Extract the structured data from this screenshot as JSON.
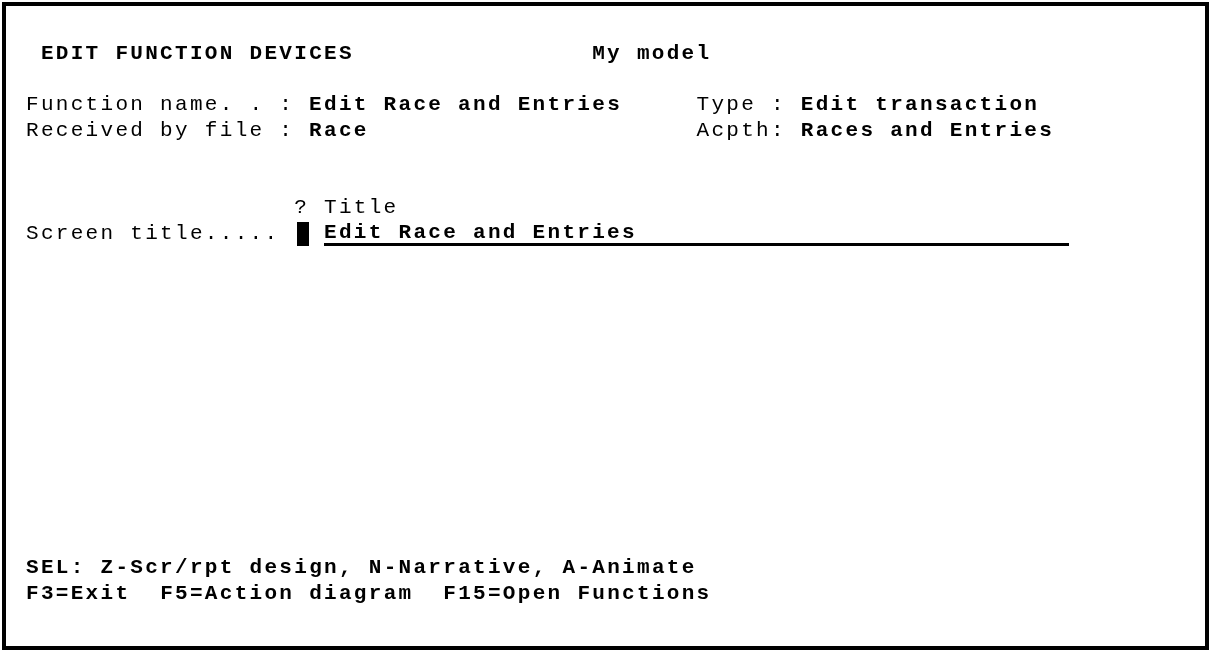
{
  "header": {
    "title": "EDIT FUNCTION DEVICES",
    "model": "My model"
  },
  "info_rows": [
    {
      "left": {
        "label": "Function name. . :",
        "value": "Edit Race and Entries"
      },
      "right": {
        "label": "Type :",
        "value": "Edit transaction"
      }
    },
    {
      "left": {
        "label": "Received by file :",
        "value": "Race"
      },
      "right": {
        "label": "Acpth:",
        "value": "Races and Entries"
      }
    }
  ],
  "entry": {
    "column_headings": [
      "?",
      "Title"
    ],
    "label": "Screen title.....",
    "prompt_field": {
      "cursor": true
    },
    "title_field": {
      "value": "Edit Race and Entries"
    }
  },
  "footer": {
    "selection_options": "SEL: Z-Scr/rpt design, N-Narrative, A-Animate",
    "function_keys": [
      "F3=Exit",
      "F5=Action diagram",
      "F15=Open Functions"
    ]
  }
}
